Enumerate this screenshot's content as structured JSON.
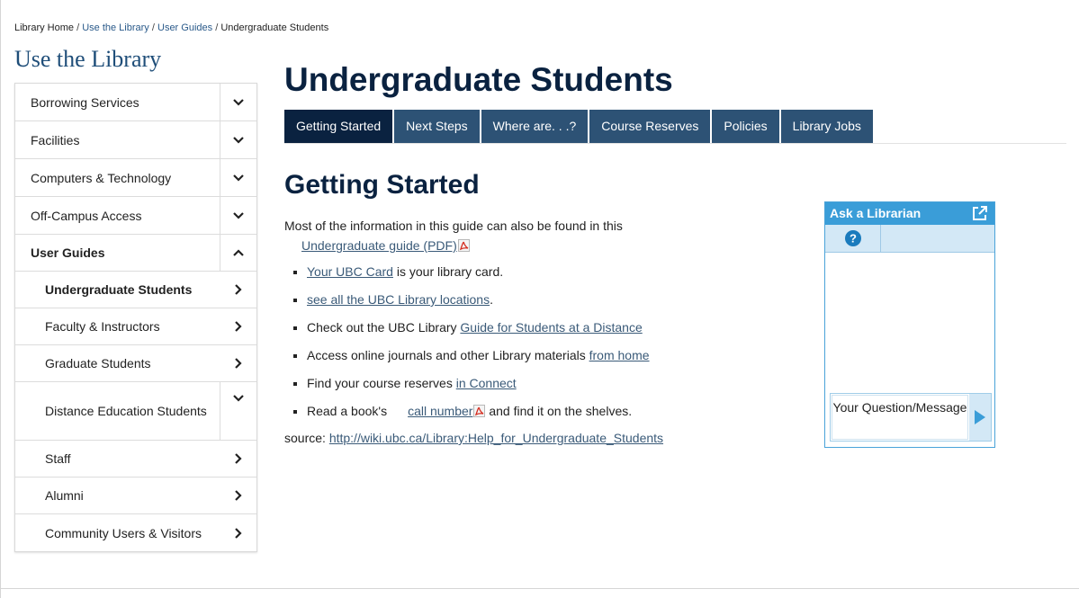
{
  "breadcrumb": {
    "items": [
      "Library Home",
      "Use the Library",
      "User Guides",
      "Undergraduate Students"
    ],
    "separator": "/"
  },
  "sidebar": {
    "title": "Use the Library",
    "items": [
      {
        "label": "Borrowing Services",
        "icon": "chevron-down-icon"
      },
      {
        "label": "Facilities",
        "icon": "chevron-down-icon"
      },
      {
        "label": "Computers & Technology",
        "icon": "chevron-down-icon"
      },
      {
        "label": "Off-Campus Access",
        "icon": "chevron-down-icon"
      },
      {
        "label": "User Guides",
        "icon": "chevron-up-icon"
      }
    ],
    "sub_items": [
      {
        "label": "Undergraduate Students",
        "icon": "chevron-right-icon"
      },
      {
        "label": "Faculty & Instructors",
        "icon": "chevron-right-icon"
      },
      {
        "label": "Graduate Students",
        "icon": "chevron-right-icon"
      },
      {
        "label": "Distance Education Students",
        "icon": "chevron-down-icon"
      },
      {
        "label": "Staff",
        "icon": "chevron-right-icon"
      },
      {
        "label": "Alumni",
        "icon": "chevron-right-icon"
      },
      {
        "label": "Community Users & Visitors",
        "icon": "chevron-right-icon"
      }
    ]
  },
  "main": {
    "title": "Undergraduate Students",
    "tabs": [
      {
        "label": "Getting Started",
        "active": true
      },
      {
        "label": "Next Steps"
      },
      {
        "label": "Where are. . .?"
      },
      {
        "label": "Course Reserves"
      },
      {
        "label": "Policies"
      },
      {
        "label": "Library Jobs"
      }
    ],
    "section_title": "Getting Started",
    "intro_text": "Most of the information in this guide can also be found in this",
    "intro_link": "Undergraduate guide (PDF)",
    "bullets": [
      {
        "link": "Your UBC Card",
        "after": " is your library card."
      },
      {
        "link": "see all the UBC Library locations",
        "after": "."
      },
      {
        "before": "Check out the UBC Library ",
        "link": "Guide for Students at a Distance"
      },
      {
        "before": "Access online journals and other Library materials ",
        "link": "from home"
      },
      {
        "before": "Find your course reserves ",
        "link": "in Connect"
      },
      {
        "before": "Read a book's",
        "link": "call number",
        "after": " and find it on the shelves."
      }
    ],
    "source_label": "source: ",
    "source_url": "http://wiki.ubc.ca/Library:Help_for_Undergraduate_Students"
  },
  "ask_widget": {
    "title": "Ask a Librarian",
    "input_label": "Your Question/Message"
  },
  "colors": {
    "nav_dark": "#0a2240",
    "tab_blue": "#2d5275",
    "widget_blue": "#3a9dd8",
    "link": "#3a5a78"
  }
}
